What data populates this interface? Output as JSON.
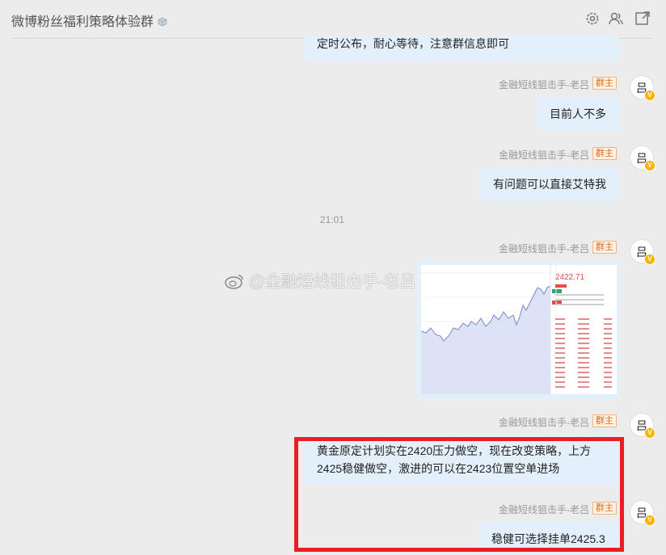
{
  "header": {
    "title": "微博粉丝福利策略体验群",
    "settings_icon": "gear-icon",
    "members_icon": "members-icon",
    "popout_icon": "open-external-icon"
  },
  "sender": {
    "name": "金融短线狙击手-老吕",
    "badge": "群主",
    "avatar_glyph": "吕"
  },
  "messages": [
    {
      "text": "定时公布，耐心等待，注意群信息即可"
    },
    {
      "text": "目前人不多"
    },
    {
      "text": "有问题可以直接艾特我"
    },
    {
      "time": "21:01"
    },
    {
      "image": "chart-screenshot"
    },
    {
      "text": "黄金原定计划实在2420压力做空，现在改变策略，上方2425稳健做空，激进的可以在2423位置空单进场"
    },
    {
      "text": "稳健可选择挂单2425.3"
    }
  ],
  "watermark": "@金融短线狙击手-老吕",
  "shot": {
    "price": "2422.71"
  },
  "colors": {
    "bubble": "#e3f0fb",
    "badge": "#e36a1c",
    "highlight": "#ec1c24",
    "verified": "#f7b400"
  }
}
